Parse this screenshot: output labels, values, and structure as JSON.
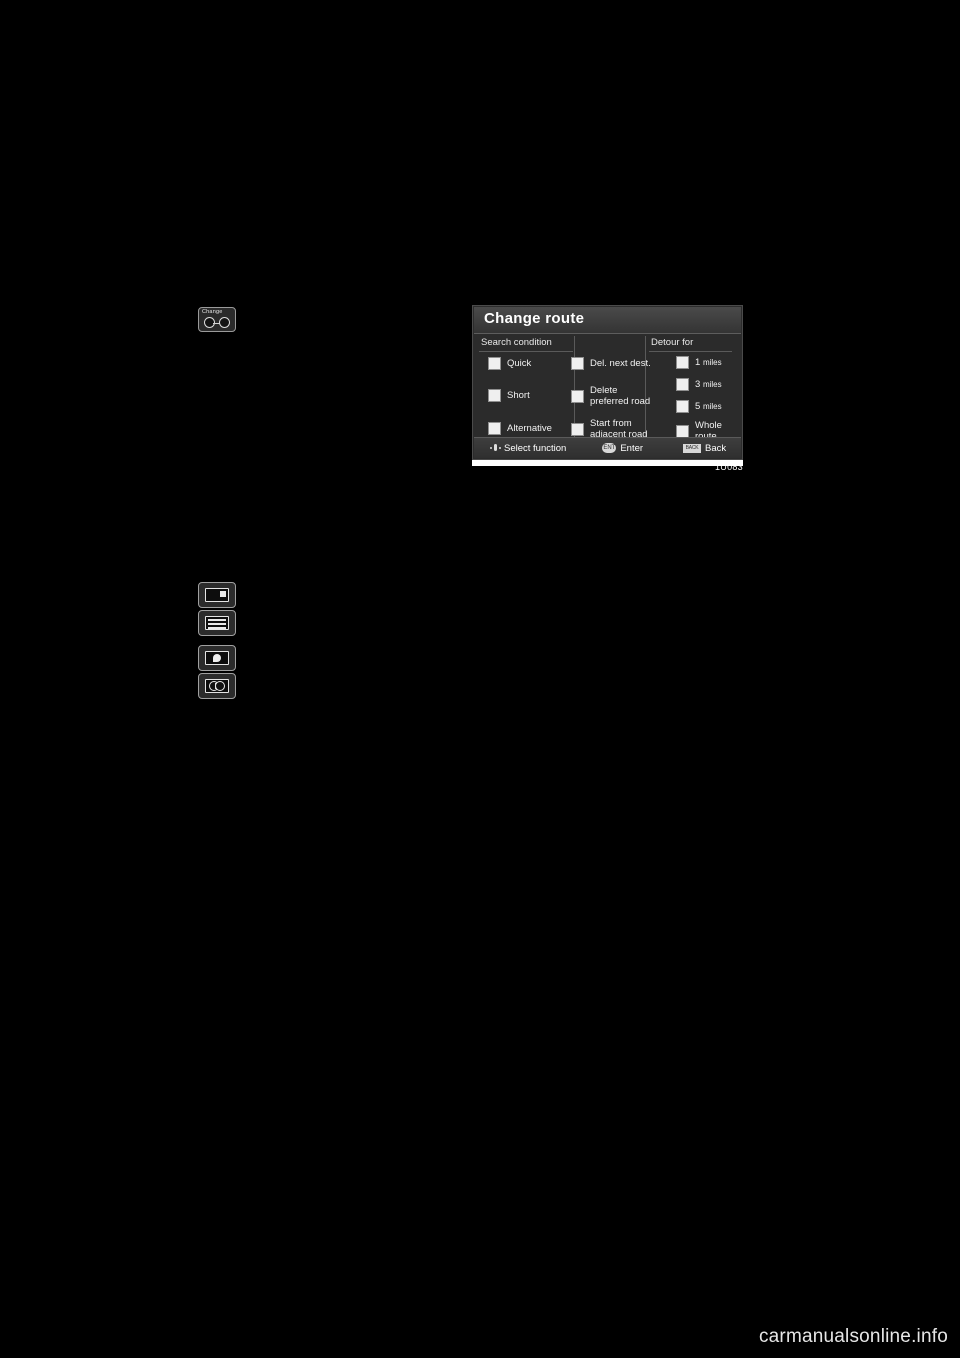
{
  "page": {
    "background_color": "#000000",
    "watermark": "carmanualsonline.info"
  },
  "left_column": {
    "change_button": {
      "label": "Change",
      "icon": "change-knob-icon"
    },
    "stacked_buttons": [
      {
        "name": "map-view-button",
        "icon": "map-screen-icon"
      },
      {
        "name": "list-view-button",
        "icon": "list-lines-icon"
      },
      {
        "name": "destination-button",
        "icon": "destination-pin-icon"
      },
      {
        "name": "audio-button",
        "icon": "audio-dials-icon"
      }
    ]
  },
  "nav_screen": {
    "title": "Change route",
    "columns": {
      "search_condition": "Search condition",
      "delete_group": "",
      "detour_for": "Detour for"
    },
    "search_condition_items": [
      {
        "label": "Quick",
        "checked": false
      },
      {
        "label": "Short",
        "checked": false
      },
      {
        "label": "Alternative",
        "checked": false
      }
    ],
    "middle_items": [
      {
        "label": "Del. next dest.",
        "checked": false
      },
      {
        "label": "Delete\npreferred road",
        "line1": "Delete",
        "line2": "preferred road",
        "checked": false
      },
      {
        "label": "Start from\nadjacent road",
        "line1": "Start from",
        "line2": "adjacent road",
        "checked": false
      }
    ],
    "detour_items": [
      {
        "value": "1",
        "unit": "miles",
        "checked": false
      },
      {
        "value": "3",
        "unit": "miles",
        "checked": false
      },
      {
        "value": "5",
        "unit": "miles",
        "checked": false
      },
      {
        "line1": "Whole",
        "line2": "route",
        "checked": false
      }
    ],
    "footer": {
      "select_function": "Select function",
      "enter_badge": "ENT",
      "enter": "Enter",
      "back_badge": "BACK",
      "back": "Back"
    },
    "figure_code": "1U083"
  }
}
